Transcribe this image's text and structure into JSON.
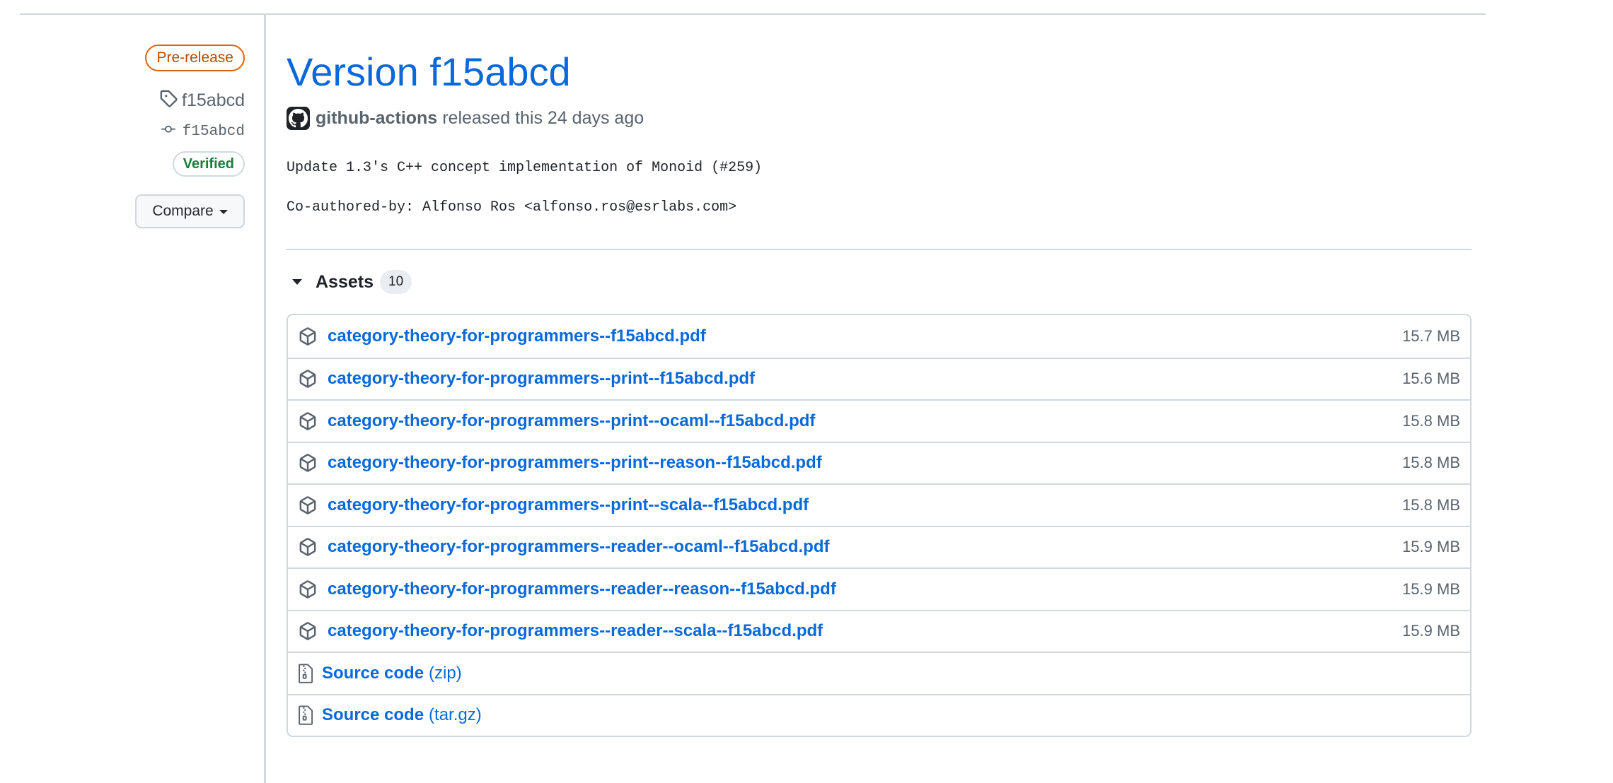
{
  "sidebar": {
    "prerelease_label": "Pre-release",
    "tag": "f15abcd",
    "commit": "f15abcd",
    "verified_label": "Verified",
    "compare_label": "Compare"
  },
  "release": {
    "title": "Version f15abcd",
    "author": "github-actions",
    "released_text": "released this 24 days ago",
    "notes": [
      "Update 1.3's C++ concept implementation of Monoid (#259)",
      "Co-authored-by: Alfonso Ros <alfonso.ros@esrlabs.com>"
    ]
  },
  "assets": {
    "title": "Assets",
    "count": "10",
    "files": [
      {
        "name": "category-theory-for-programmers--f15abcd.pdf",
        "size": "15.7 MB"
      },
      {
        "name": "category-theory-for-programmers--print--f15abcd.pdf",
        "size": "15.6 MB"
      },
      {
        "name": "category-theory-for-programmers--print--ocaml--f15abcd.pdf",
        "size": "15.8 MB"
      },
      {
        "name": "category-theory-for-programmers--print--reason--f15abcd.pdf",
        "size": "15.8 MB"
      },
      {
        "name": "category-theory-for-programmers--print--scala--f15abcd.pdf",
        "size": "15.8 MB"
      },
      {
        "name": "category-theory-for-programmers--reader--ocaml--f15abcd.pdf",
        "size": "15.9 MB"
      },
      {
        "name": "category-theory-for-programmers--reader--reason--f15abcd.pdf",
        "size": "15.9 MB"
      },
      {
        "name": "category-theory-for-programmers--reader--scala--f15abcd.pdf",
        "size": "15.9 MB"
      }
    ],
    "source": [
      {
        "label": "Source code",
        "ext": "(zip)"
      },
      {
        "label": "Source code",
        "ext": "(tar.gz)"
      }
    ]
  },
  "colors": {
    "link": "#0969da",
    "prerelease": "#bc4c00",
    "verified": "#1a7f37",
    "muted": "#59636e",
    "border": "#d0d7de"
  },
  "icons": {
    "tag": "tag-icon",
    "commit": "git-commit-icon",
    "package": "package-icon",
    "file_zip": "file-zip-icon",
    "caret": "triangle-down-icon",
    "avatar": "github-mark-icon"
  }
}
